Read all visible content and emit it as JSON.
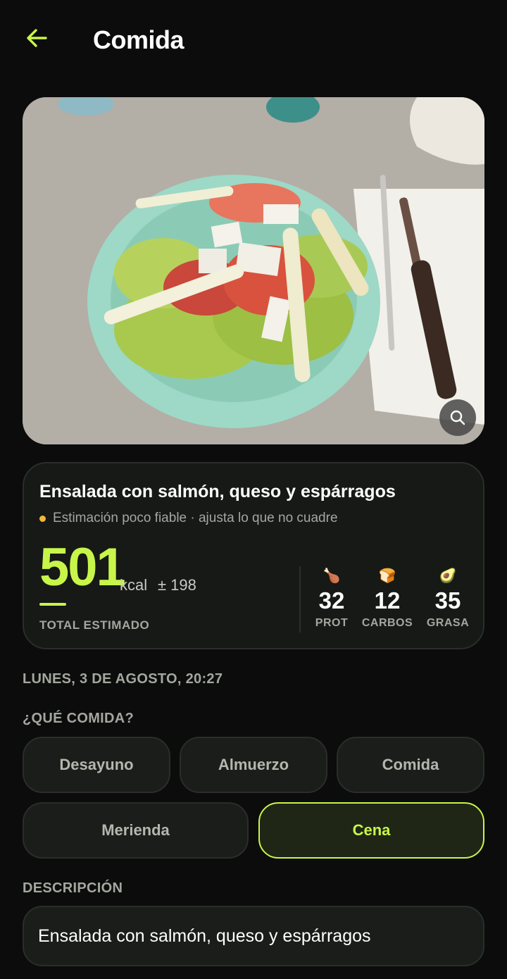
{
  "header": {
    "title": "Comida"
  },
  "photo": {
    "zoom_icon": "search-icon"
  },
  "summary": {
    "food_name": "Ensalada con salmón, queso y espárragos",
    "reliability_text": "Estimación poco fiable · ajusta lo que no cuadre",
    "kcal": "501",
    "kcal_unit": "kcal",
    "kcal_margin": "± 198",
    "total_label": "TOTAL ESTIMADO",
    "macros": [
      {
        "icon": "meat-icon",
        "glyph": "🍗",
        "value": "32",
        "label": "PROT"
      },
      {
        "icon": "bread-icon",
        "glyph": "🍞",
        "value": "12",
        "label": "CARBOS"
      },
      {
        "icon": "avocado-icon",
        "glyph": "🥑",
        "value": "35",
        "label": "GRASA"
      }
    ]
  },
  "datetime": "LUNES, 3 DE AGOSTO, 20:27",
  "meal_question": "¿QUÉ COMIDA?",
  "meal_options": [
    {
      "label": "Desayuno",
      "selected": false
    },
    {
      "label": "Almuerzo",
      "selected": false
    },
    {
      "label": "Comida",
      "selected": false
    },
    {
      "label": "Merienda",
      "selected": false
    },
    {
      "label": "Cena",
      "selected": true
    }
  ],
  "description": {
    "label": "DESCRIPCIÓN",
    "value": "Ensalada con salmón, queso y espárragos"
  },
  "colors": {
    "accent": "#c8f54a",
    "warning_dot": "#f3b63d",
    "background": "#0b0c0b"
  }
}
